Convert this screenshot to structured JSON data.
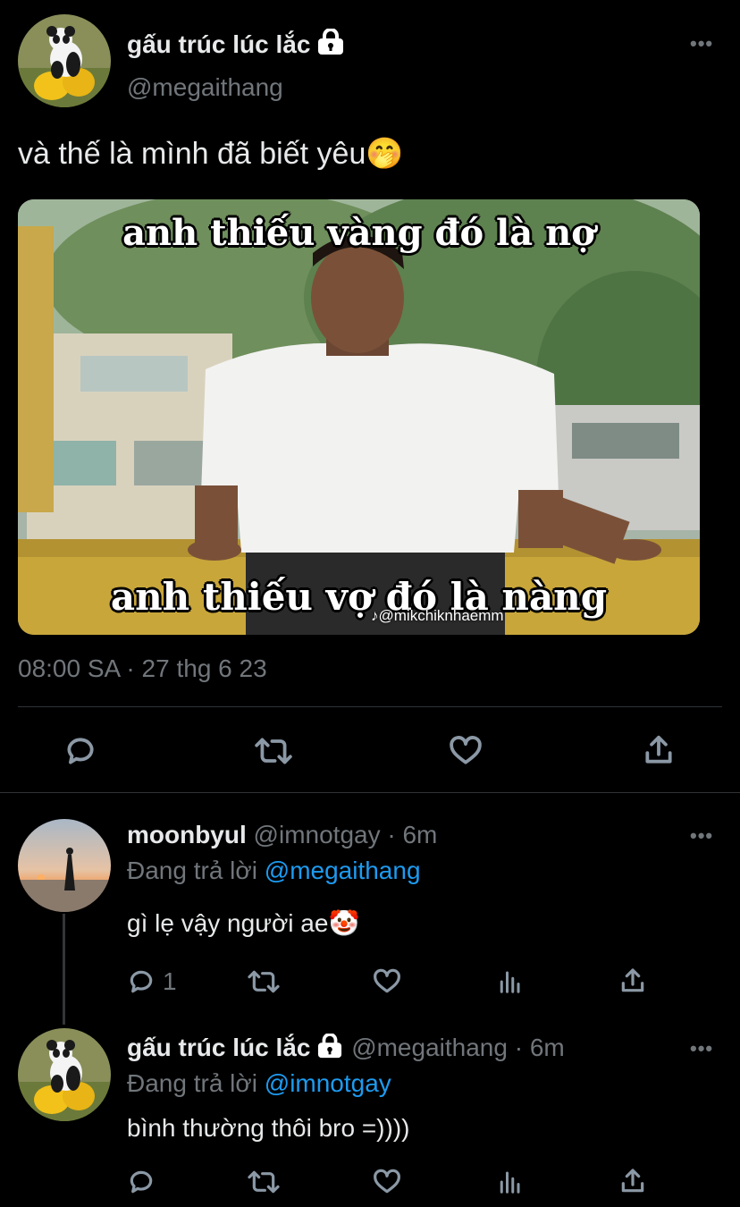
{
  "tweet": {
    "author_name": "gấu trúc lúc lắc",
    "author_handle": "@megaithang",
    "text": "và thế là mình đã biết yêu",
    "emoji": "🤭",
    "timestamp": "08:00 SA · 27 thg 6 23",
    "media": {
      "top_caption": "anh thiếu vàng đó là nợ",
      "bottom_caption": "anh thiếu vợ đó là nàng",
      "watermark": "@mikchiknhaemm"
    }
  },
  "replies": [
    {
      "author_name": "moonbyul",
      "author_handle": "@imnotgay",
      "time": "· 6m",
      "replying_label": "Đang trả lời",
      "replying_to": "@megaithang",
      "text": "gì lẹ vậy người ae",
      "emoji": "🤡",
      "reply_count": "1"
    },
    {
      "author_name": "gấu trúc lúc lắc",
      "author_handle": "@megaithang",
      "time": "· 6m",
      "replying_label": "Đang trả lời",
      "replying_to": "@imnotgay",
      "text": "bình thường thôi bro =))))",
      "reply_count": ""
    }
  ],
  "more_label": "•••",
  "icons": [
    "reply-icon",
    "retweet-icon",
    "like-icon",
    "share-icon",
    "views-icon",
    "lock-icon"
  ],
  "colors": {
    "background": "#000000",
    "text": "#e7e9ea",
    "muted": "#71767b",
    "link": "#1d9bf0",
    "divider": "#2f3336"
  }
}
